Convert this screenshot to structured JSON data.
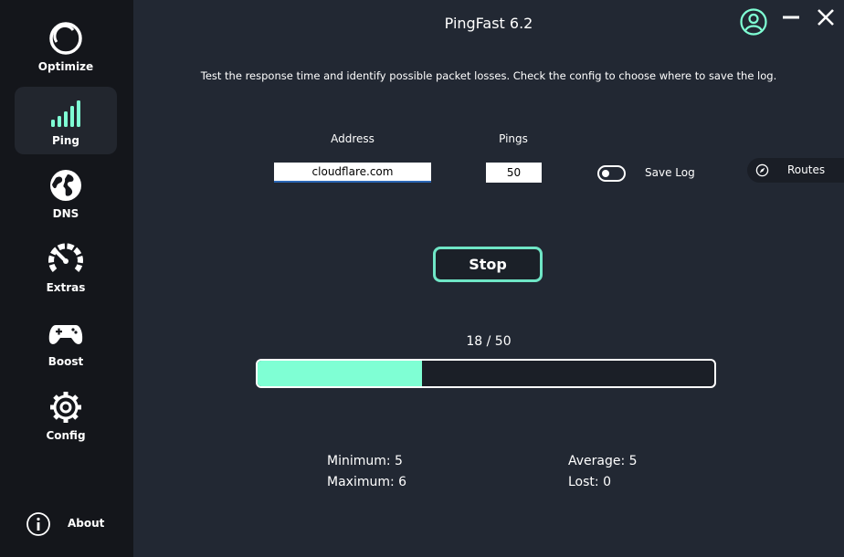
{
  "app": {
    "title": "PingFast 6.2"
  },
  "sidebar": {
    "items": [
      {
        "label": "Optimize",
        "icon": "optimize-icon"
      },
      {
        "label": "Ping",
        "icon": "signal-bars-icon",
        "active": true
      },
      {
        "label": "DNS",
        "icon": "globe-icon"
      },
      {
        "label": "Extras",
        "icon": "gauge-icon"
      },
      {
        "label": "Boost",
        "icon": "gamepad-icon"
      },
      {
        "label": "Config",
        "icon": "gear-icon"
      }
    ],
    "about": {
      "label": "About",
      "icon": "info-icon"
    }
  },
  "window": {
    "icons": [
      "user-icon",
      "minimize-icon",
      "close-icon"
    ]
  },
  "main": {
    "description": "Test the response time and identify possible packet losses. Check the config to choose where to save the log.",
    "address": {
      "label": "Address",
      "value": "cloudflare.com"
    },
    "pings": {
      "label": "Pings",
      "value": "50"
    },
    "save_log": {
      "label": "Save Log",
      "enabled": false
    },
    "routes": {
      "label": "Routes",
      "icon": "compass-icon"
    },
    "stop_button": {
      "label": "Stop"
    },
    "progress": {
      "text": "18 / 50",
      "current": 18,
      "total": 50
    },
    "stats": {
      "minimum": "Minimum: 5",
      "maximum": "Maximum: 6",
      "average": "Average: 5",
      "lost": "Lost: 0"
    }
  },
  "colors": {
    "accent": "#7fffd4",
    "background": "#222833",
    "sidebar": "#14161b"
  }
}
